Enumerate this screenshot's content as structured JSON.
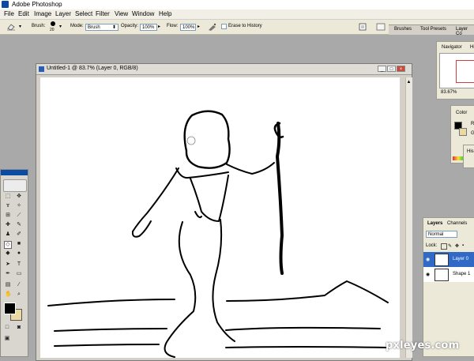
{
  "app": {
    "title": "Adobe Photoshop"
  },
  "menu": [
    "File",
    "Edit",
    "Image",
    "Layer",
    "Select",
    "Filter",
    "View",
    "Window",
    "Help"
  ],
  "options": {
    "brush_label": "Brush:",
    "brush_size": "20",
    "mode_label": "Mode:",
    "mode_value": "Brush",
    "opacity_label": "Opacity:",
    "opacity_value": "100%",
    "flow_label": "Flow:",
    "flow_value": "100%",
    "erase_history_label": "Erase to History",
    "well_tabs": [
      "Brushes",
      "Tool Presets",
      "Layer Co"
    ]
  },
  "document": {
    "title": "Untitled-1 @ 83.7% (Layer 0, RGB/8)"
  },
  "navigator": {
    "tab": "Navigator",
    "tab2": "Hi",
    "zoom": "83.67%"
  },
  "color_panel": {
    "tab": "Color",
    "channel_r": "R",
    "channel_g": "G"
  },
  "history_panel": {
    "tab": "His"
  },
  "layers_panel": {
    "tabs": [
      "Layers",
      "Channels"
    ],
    "blend_mode": "Normal",
    "lock_label": "Lock:",
    "layers": [
      {
        "name": "Layer 0",
        "selected": true
      },
      {
        "name": "Shape 1",
        "selected": false
      }
    ]
  },
  "watermark": "pxleyes.com",
  "colors": {
    "selected_layer": "#3169c6",
    "foreground": "#000000",
    "background": "#ead9a0"
  }
}
